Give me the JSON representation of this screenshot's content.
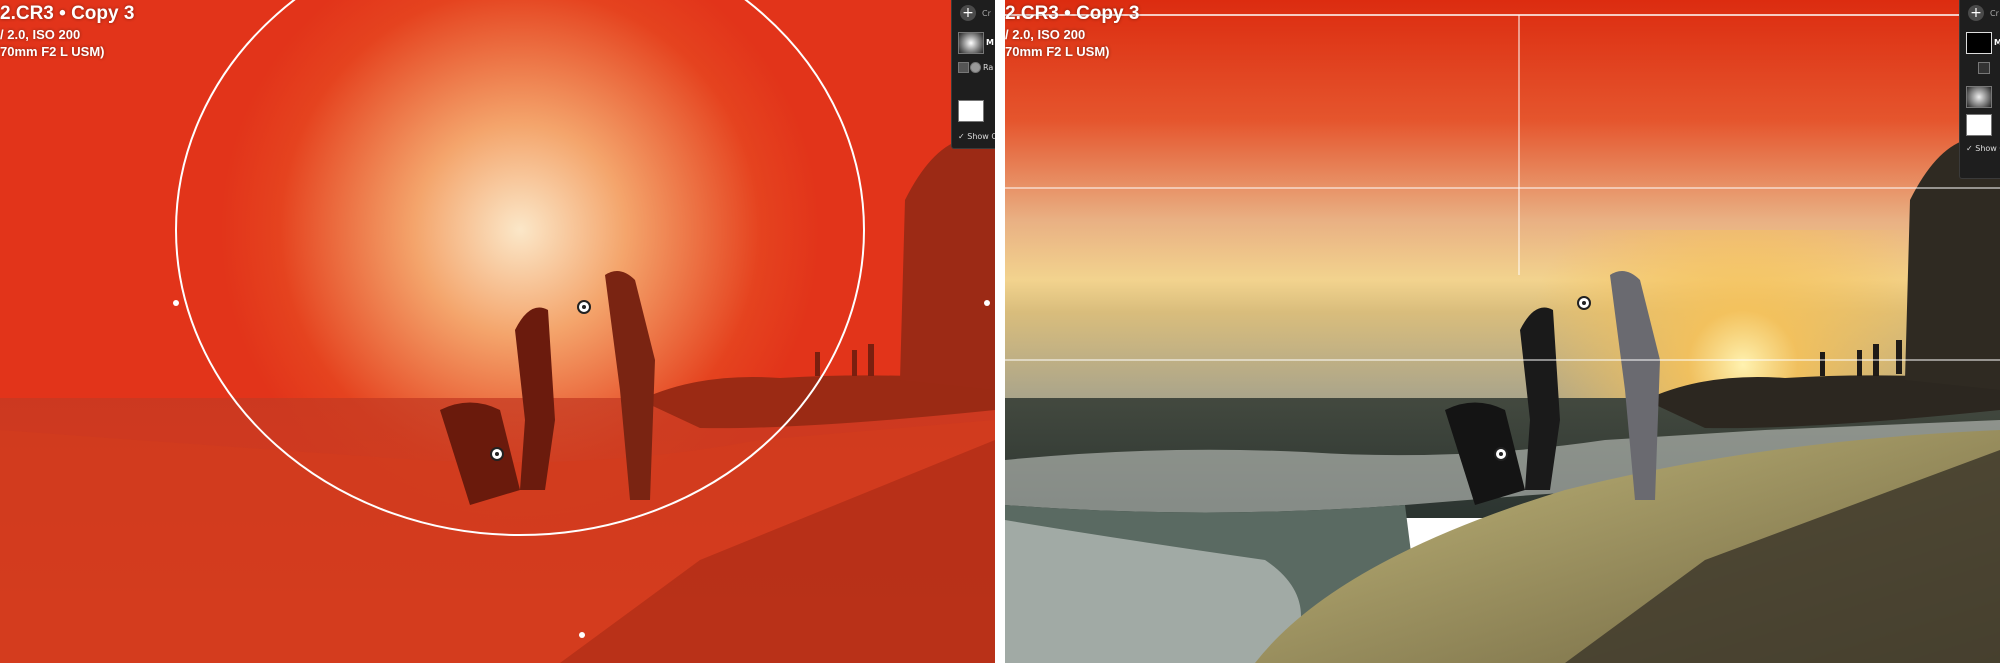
{
  "left_view": {
    "file_title": "2.CR3  •  Copy 3",
    "exposure_info": "/ 2.0, ISO 200",
    "lens_info": "70mm F2 L USM)",
    "overlay_color": "#e8331a",
    "panel": {
      "add_icon": "plus-icon",
      "create_label": "Cr",
      "mask_label": "M",
      "range_label": "Ra",
      "show_overlay_label": "Show O"
    }
  },
  "right_view": {
    "file_title": "2.CR3  •  Copy 3",
    "exposure_info": "/ 2.0, ISO 200",
    "lens_info": "70mm F2 L USM)",
    "overlay_color": "#e8331a",
    "panel": {
      "add_icon": "plus-icon",
      "create_label": "Cr",
      "mask_label": "M",
      "show_overlay_label": "Show O"
    }
  }
}
